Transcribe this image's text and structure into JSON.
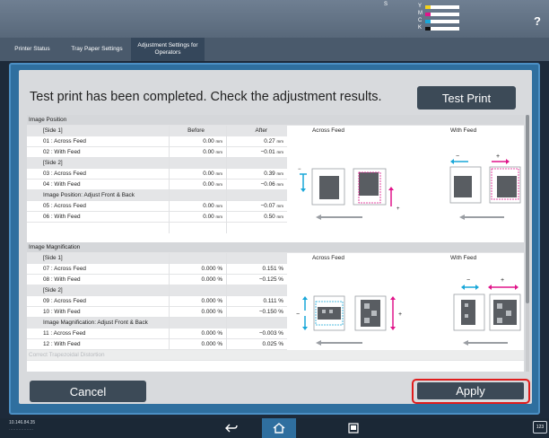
{
  "status": {
    "toner_s_label": "S",
    "toner": [
      {
        "channel": "Y",
        "color": "#f3d21c",
        "fill": 0.85
      },
      {
        "channel": "M",
        "color": "#e0158a",
        "fill": 0.85
      },
      {
        "channel": "C",
        "color": "#19a7d9",
        "fill": 0.85
      },
      {
        "channel": "K",
        "color": "#111111",
        "fill": 0.85
      }
    ],
    "help_label": "?"
  },
  "tabs": [
    {
      "label": "Printer Status"
    },
    {
      "label": "Tray Paper Settings"
    },
    {
      "label": "Adjustment Settings for Operators"
    }
  ],
  "dialog": {
    "headline": "Test print has been completed. Check the adjustment results.",
    "test_print_label": "Test Print",
    "cancel_label": "Cancel",
    "apply_label": "Apply"
  },
  "sections": [
    {
      "title": "Image Position",
      "columns": {
        "before": "Before",
        "after": "After"
      },
      "groups": [
        {
          "heading": "[Side 1]",
          "rows": [
            {
              "label": "01 : Across Feed",
              "before": "0.00",
              "after": "0.27",
              "unit": "mm"
            },
            {
              "label": "02 : With Feed",
              "before": "0.00",
              "after": "−0.01",
              "unit": "mm"
            }
          ]
        },
        {
          "heading": "[Side 2]",
          "rows": [
            {
              "label": "03 : Across Feed",
              "before": "0.00",
              "after": "0.39",
              "unit": "mm"
            },
            {
              "label": "04 : With Feed",
              "before": "0.00",
              "after": "−0.06",
              "unit": "mm"
            }
          ]
        },
        {
          "heading": "Image Position: Adjust Front & Back",
          "rows": [
            {
              "label": "05 : Across Feed",
              "before": "0.00",
              "after": "−0.07",
              "unit": "mm"
            },
            {
              "label": "06 : With Feed",
              "before": "0.00",
              "after": "0.50",
              "unit": "mm"
            }
          ]
        }
      ],
      "diagram_titles": {
        "across": "Across Feed",
        "with": "With Feed"
      }
    },
    {
      "title": "Image Magnification",
      "groups": [
        {
          "heading": "[Side 1]",
          "rows": [
            {
              "label": "07 : Across Feed",
              "before": "0.000 %",
              "after": "0.151 %"
            },
            {
              "label": "08 : With Feed",
              "before": "0.000 %",
              "after": "−0.125 %"
            }
          ]
        },
        {
          "heading": "[Side 2]",
          "rows": [
            {
              "label": "09 : Across Feed",
              "before": "0.000 %",
              "after": "0.111 %"
            },
            {
              "label": "10 : With Feed",
              "before": "0.000 %",
              "after": "−0.150 %"
            }
          ]
        },
        {
          "heading": "Image Magnification: Adjust Front & Back",
          "rows": [
            {
              "label": "11 : Across Feed",
              "before": "0.000 %",
              "after": "−0.003 %"
            },
            {
              "label": "12 : With Feed",
              "before": "0.000 %",
              "after": "0.025 %"
            }
          ]
        }
      ],
      "diagram_titles": {
        "across": "Across Feed",
        "with": "With Feed"
      }
    }
  ],
  "next_section": "Correct Trapezoidal Distortion",
  "bottom": {
    "ip": "10.146.84.35",
    "ip_sub": "․․․․․․․․․․․․․․․․․․",
    "keyboard_label": "123"
  },
  "colors": {
    "accent": "#2f6f9f",
    "highlight": "#e01c1c",
    "button": "#3c4a57",
    "magenta_arrow": "#e0158a",
    "cyan_arrow": "#19a7d9"
  }
}
